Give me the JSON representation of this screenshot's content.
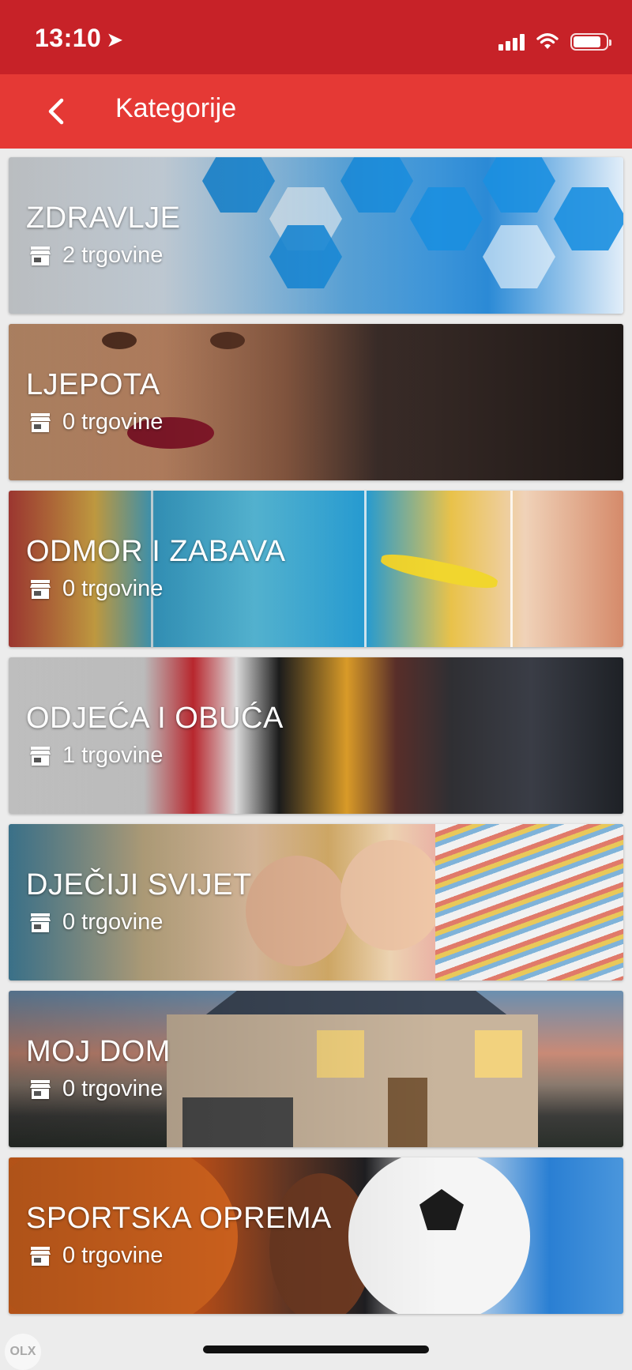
{
  "status_bar": {
    "time": "13:10",
    "location_icon": "location-arrow-icon",
    "battery_level": 0.85
  },
  "header": {
    "title": "Kategorije",
    "back_icon": "chevron-left-icon"
  },
  "categories": [
    {
      "title": "ZDRAVLJE",
      "count": "2 trgovine",
      "theme": "health"
    },
    {
      "title": "LJEPOTA",
      "count": "0 trgovine",
      "theme": "beauty"
    },
    {
      "title": "ODMOR I ZABAVA",
      "count": "0 trgovine",
      "theme": "holiday"
    },
    {
      "title": "ODJEĆA I OBUĆA",
      "count": "1 trgovine",
      "theme": "clothes"
    },
    {
      "title": "DJEČIJI SVIJET",
      "count": "0 trgovine",
      "theme": "kids"
    },
    {
      "title": "MOJ DOM",
      "count": "0 trgovine",
      "theme": "home"
    },
    {
      "title": "SPORTSKA OPREMA",
      "count": "0 trgovine",
      "theme": "sport"
    }
  ],
  "colors": {
    "status_bar": "#c72228",
    "app_bar": "#e53935",
    "background": "#ececec"
  },
  "watermark": "OLX"
}
